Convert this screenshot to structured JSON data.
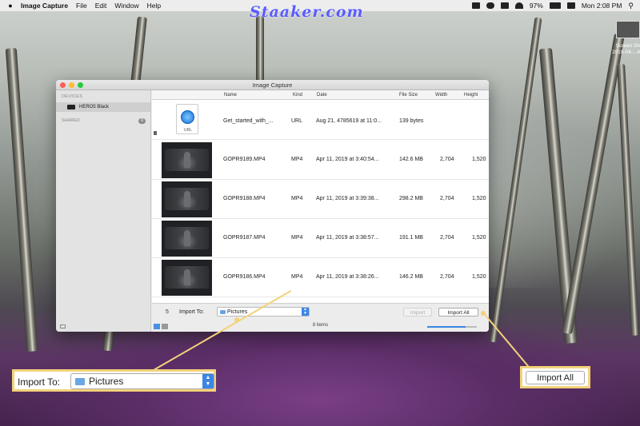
{
  "menubar": {
    "app": "Image Capture",
    "items": [
      "File",
      "Edit",
      "Window",
      "Help"
    ],
    "battery": "97%",
    "clock": "Mon 2:08 PM"
  },
  "watermark": "Staaker.com",
  "desktop": {
    "icon_label_1": "Screen Sh",
    "icon_label_2": "2019-04-...4"
  },
  "window": {
    "title": "Image Capture",
    "sidebar": {
      "devices_header": "DEVICES",
      "device": "HERO5 Black",
      "shared_header": "SHARED",
      "shared_count": "0"
    },
    "columns": [
      "Name",
      "Kind",
      "Date",
      "File Size",
      "Width",
      "Height"
    ],
    "rows": [
      {
        "name": "Get_started_with_...",
        "kind": "URL",
        "date": "Aug 21, 4785619 at 11:0...",
        "size": "139 bytes",
        "width": "",
        "height": "",
        "thumb": "url"
      },
      {
        "name": "GOPR9189.MP4",
        "kind": "MP4",
        "date": "Apr 11, 2019 at 3:40:54...",
        "size": "142.6 MB",
        "width": "2,704",
        "height": "1,520",
        "thumb": "video"
      },
      {
        "name": "GOPR9188.MP4",
        "kind": "MP4",
        "date": "Apr 11, 2019 at 3:39:38...",
        "size": "298.2 MB",
        "width": "2,704",
        "height": "1,520",
        "thumb": "video"
      },
      {
        "name": "GOPR9187.MP4",
        "kind": "MP4",
        "date": "Apr 11, 2019 at 3:38:57...",
        "size": "191.1 MB",
        "width": "2,704",
        "height": "1,520",
        "thumb": "video"
      },
      {
        "name": "GOPR9186.MP4",
        "kind": "MP4",
        "date": "Apr 11, 2019 at 3:38:26...",
        "size": "146.2 MB",
        "width": "2,704",
        "height": "1,520",
        "thumb": "video"
      }
    ],
    "url_icon_label": "URL",
    "footer": {
      "count": "5",
      "import_to_label": "Import To:",
      "destination": "Pictures",
      "import_button": "Import",
      "import_all_button": "Import All",
      "items_text": "8 items"
    }
  },
  "callouts": {
    "import_to_label": "Import To:",
    "destination": "Pictures",
    "import_all": "Import All"
  },
  "colors": {
    "callout": "#f3d27a",
    "accent": "#3b86e4"
  }
}
